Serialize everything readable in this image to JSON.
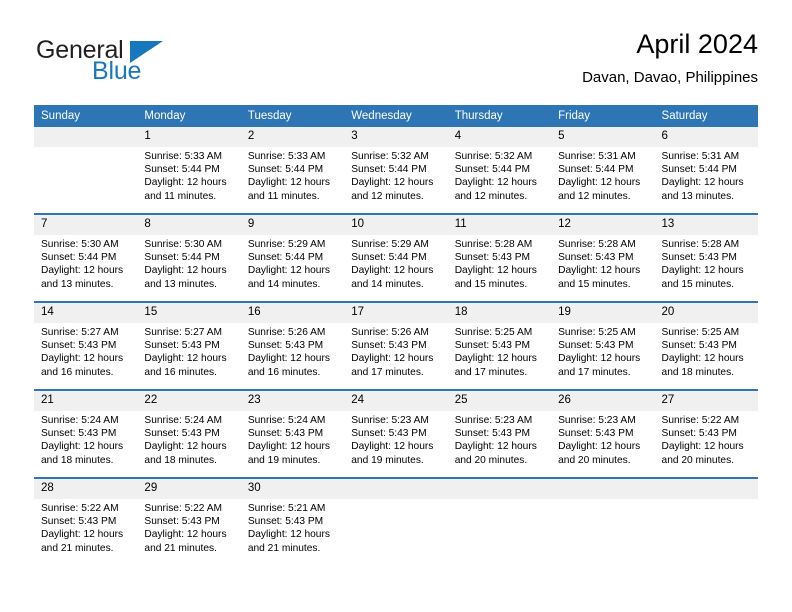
{
  "brand": {
    "name_part1": "General",
    "name_part2": "Blue",
    "logo_icon": "triangle-icon"
  },
  "header": {
    "month_title": "April 2024",
    "location": "Davan, Davao, Philippines"
  },
  "colors": {
    "header_blue": "#2e75b6",
    "brand_blue": "#1878be",
    "daynum_band": "#f0f0f0",
    "text": "#000000"
  },
  "calendar": {
    "weekday_headers": [
      "Sunday",
      "Monday",
      "Tuesday",
      "Wednesday",
      "Thursday",
      "Friday",
      "Saturday"
    ],
    "weeks": [
      [
        {
          "day": "",
          "sunrise": "",
          "sunset": "",
          "daylight1": "",
          "daylight2": ""
        },
        {
          "day": "1",
          "sunrise": "Sunrise: 5:33 AM",
          "sunset": "Sunset: 5:44 PM",
          "daylight1": "Daylight: 12 hours",
          "daylight2": "and 11 minutes."
        },
        {
          "day": "2",
          "sunrise": "Sunrise: 5:33 AM",
          "sunset": "Sunset: 5:44 PM",
          "daylight1": "Daylight: 12 hours",
          "daylight2": "and 11 minutes."
        },
        {
          "day": "3",
          "sunrise": "Sunrise: 5:32 AM",
          "sunset": "Sunset: 5:44 PM",
          "daylight1": "Daylight: 12 hours",
          "daylight2": "and 12 minutes."
        },
        {
          "day": "4",
          "sunrise": "Sunrise: 5:32 AM",
          "sunset": "Sunset: 5:44 PM",
          "daylight1": "Daylight: 12 hours",
          "daylight2": "and 12 minutes."
        },
        {
          "day": "5",
          "sunrise": "Sunrise: 5:31 AM",
          "sunset": "Sunset: 5:44 PM",
          "daylight1": "Daylight: 12 hours",
          "daylight2": "and 12 minutes."
        },
        {
          "day": "6",
          "sunrise": "Sunrise: 5:31 AM",
          "sunset": "Sunset: 5:44 PM",
          "daylight1": "Daylight: 12 hours",
          "daylight2": "and 13 minutes."
        }
      ],
      [
        {
          "day": "7",
          "sunrise": "Sunrise: 5:30 AM",
          "sunset": "Sunset: 5:44 PM",
          "daylight1": "Daylight: 12 hours",
          "daylight2": "and 13 minutes."
        },
        {
          "day": "8",
          "sunrise": "Sunrise: 5:30 AM",
          "sunset": "Sunset: 5:44 PM",
          "daylight1": "Daylight: 12 hours",
          "daylight2": "and 13 minutes."
        },
        {
          "day": "9",
          "sunrise": "Sunrise: 5:29 AM",
          "sunset": "Sunset: 5:44 PM",
          "daylight1": "Daylight: 12 hours",
          "daylight2": "and 14 minutes."
        },
        {
          "day": "10",
          "sunrise": "Sunrise: 5:29 AM",
          "sunset": "Sunset: 5:44 PM",
          "daylight1": "Daylight: 12 hours",
          "daylight2": "and 14 minutes."
        },
        {
          "day": "11",
          "sunrise": "Sunrise: 5:28 AM",
          "sunset": "Sunset: 5:43 PM",
          "daylight1": "Daylight: 12 hours",
          "daylight2": "and 15 minutes."
        },
        {
          "day": "12",
          "sunrise": "Sunrise: 5:28 AM",
          "sunset": "Sunset: 5:43 PM",
          "daylight1": "Daylight: 12 hours",
          "daylight2": "and 15 minutes."
        },
        {
          "day": "13",
          "sunrise": "Sunrise: 5:28 AM",
          "sunset": "Sunset: 5:43 PM",
          "daylight1": "Daylight: 12 hours",
          "daylight2": "and 15 minutes."
        }
      ],
      [
        {
          "day": "14",
          "sunrise": "Sunrise: 5:27 AM",
          "sunset": "Sunset: 5:43 PM",
          "daylight1": "Daylight: 12 hours",
          "daylight2": "and 16 minutes."
        },
        {
          "day": "15",
          "sunrise": "Sunrise: 5:27 AM",
          "sunset": "Sunset: 5:43 PM",
          "daylight1": "Daylight: 12 hours",
          "daylight2": "and 16 minutes."
        },
        {
          "day": "16",
          "sunrise": "Sunrise: 5:26 AM",
          "sunset": "Sunset: 5:43 PM",
          "daylight1": "Daylight: 12 hours",
          "daylight2": "and 16 minutes."
        },
        {
          "day": "17",
          "sunrise": "Sunrise: 5:26 AM",
          "sunset": "Sunset: 5:43 PM",
          "daylight1": "Daylight: 12 hours",
          "daylight2": "and 17 minutes."
        },
        {
          "day": "18",
          "sunrise": "Sunrise: 5:25 AM",
          "sunset": "Sunset: 5:43 PM",
          "daylight1": "Daylight: 12 hours",
          "daylight2": "and 17 minutes."
        },
        {
          "day": "19",
          "sunrise": "Sunrise: 5:25 AM",
          "sunset": "Sunset: 5:43 PM",
          "daylight1": "Daylight: 12 hours",
          "daylight2": "and 17 minutes."
        },
        {
          "day": "20",
          "sunrise": "Sunrise: 5:25 AM",
          "sunset": "Sunset: 5:43 PM",
          "daylight1": "Daylight: 12 hours",
          "daylight2": "and 18 minutes."
        }
      ],
      [
        {
          "day": "21",
          "sunrise": "Sunrise: 5:24 AM",
          "sunset": "Sunset: 5:43 PM",
          "daylight1": "Daylight: 12 hours",
          "daylight2": "and 18 minutes."
        },
        {
          "day": "22",
          "sunrise": "Sunrise: 5:24 AM",
          "sunset": "Sunset: 5:43 PM",
          "daylight1": "Daylight: 12 hours",
          "daylight2": "and 18 minutes."
        },
        {
          "day": "23",
          "sunrise": "Sunrise: 5:24 AM",
          "sunset": "Sunset: 5:43 PM",
          "daylight1": "Daylight: 12 hours",
          "daylight2": "and 19 minutes."
        },
        {
          "day": "24",
          "sunrise": "Sunrise: 5:23 AM",
          "sunset": "Sunset: 5:43 PM",
          "daylight1": "Daylight: 12 hours",
          "daylight2": "and 19 minutes."
        },
        {
          "day": "25",
          "sunrise": "Sunrise: 5:23 AM",
          "sunset": "Sunset: 5:43 PM",
          "daylight1": "Daylight: 12 hours",
          "daylight2": "and 20 minutes."
        },
        {
          "day": "26",
          "sunrise": "Sunrise: 5:23 AM",
          "sunset": "Sunset: 5:43 PM",
          "daylight1": "Daylight: 12 hours",
          "daylight2": "and 20 minutes."
        },
        {
          "day": "27",
          "sunrise": "Sunrise: 5:22 AM",
          "sunset": "Sunset: 5:43 PM",
          "daylight1": "Daylight: 12 hours",
          "daylight2": "and 20 minutes."
        }
      ],
      [
        {
          "day": "28",
          "sunrise": "Sunrise: 5:22 AM",
          "sunset": "Sunset: 5:43 PM",
          "daylight1": "Daylight: 12 hours",
          "daylight2": "and 21 minutes."
        },
        {
          "day": "29",
          "sunrise": "Sunrise: 5:22 AM",
          "sunset": "Sunset: 5:43 PM",
          "daylight1": "Daylight: 12 hours",
          "daylight2": "and 21 minutes."
        },
        {
          "day": "30",
          "sunrise": "Sunrise: 5:21 AM",
          "sunset": "Sunset: 5:43 PM",
          "daylight1": "Daylight: 12 hours",
          "daylight2": "and 21 minutes."
        },
        {
          "day": "",
          "sunrise": "",
          "sunset": "",
          "daylight1": "",
          "daylight2": ""
        },
        {
          "day": "",
          "sunrise": "",
          "sunset": "",
          "daylight1": "",
          "daylight2": ""
        },
        {
          "day": "",
          "sunrise": "",
          "sunset": "",
          "daylight1": "",
          "daylight2": ""
        },
        {
          "day": "",
          "sunrise": "",
          "sunset": "",
          "daylight1": "",
          "daylight2": ""
        }
      ]
    ]
  }
}
